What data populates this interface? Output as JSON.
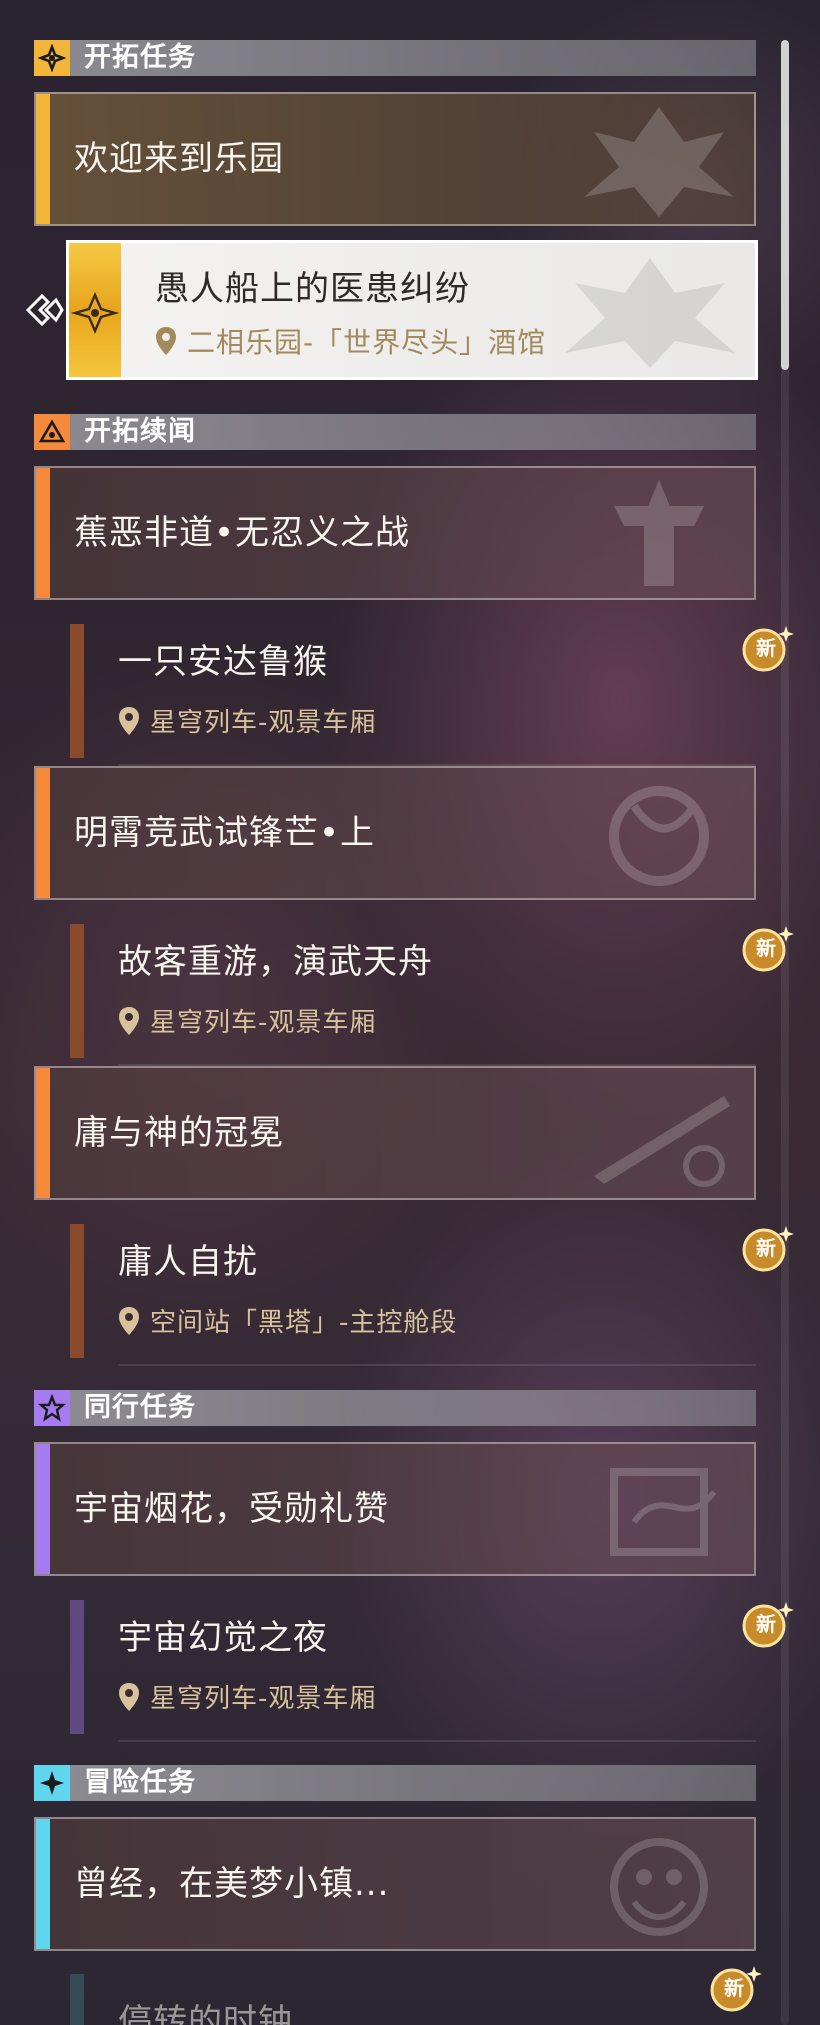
{
  "sections": [
    {
      "title": "开拓任务",
      "icon": "trailblaze-mission-icon",
      "color": "#f2b63a"
    },
    {
      "title": "开拓续闻",
      "icon": "trailblaze-continuance-icon",
      "color": "#f58a3c"
    },
    {
      "title": "同行任务",
      "icon": "companion-mission-icon",
      "color": "#a77bf0"
    },
    {
      "title": "冒险任务",
      "icon": "adventure-mission-icon",
      "color": "#5fd6ee"
    }
  ],
  "trailblaze": {
    "quest": {
      "title": "欢迎来到乐园"
    },
    "selected": {
      "title": "愚人船上的医患纠纷",
      "location": "二相乐园-「世界尽头」酒馆"
    }
  },
  "continuance": [
    {
      "title": "蕉恶非道•无忍义之战",
      "sub_title": "一只安达鲁猴",
      "sub_location": "星穹列车-观景车厢",
      "badge": "新"
    },
    {
      "title": "明霄竞武试锋芒•上",
      "sub_title": "故客重游，演武天舟",
      "sub_location": "星穹列车-观景车厢",
      "badge": "新"
    },
    {
      "title": "庸与神的冠冕",
      "sub_title": "庸人自扰",
      "sub_location": "空间站「黑塔」-主控舱段",
      "badge": "新"
    }
  ],
  "companion": [
    {
      "title": "宇宙烟花，受勋礼赞",
      "sub_title": "宇宙幻觉之夜",
      "sub_location": "星穹列车-观景车厢",
      "badge": "新"
    }
  ],
  "adventure": [
    {
      "title": "曾经，在美梦小镇...",
      "sub_title": "停转的时钟",
      "badge": "新"
    }
  ],
  "colors": {
    "gold": "#f2b63a",
    "orange": "#f58a3c",
    "orange_dark": "#8a4a2c",
    "purple": "#a77bf0",
    "purple_dark": "#5e4a80",
    "cyan": "#5fd6ee",
    "cyan_dark": "#3d6a78",
    "location_text": "#d8c29c"
  }
}
